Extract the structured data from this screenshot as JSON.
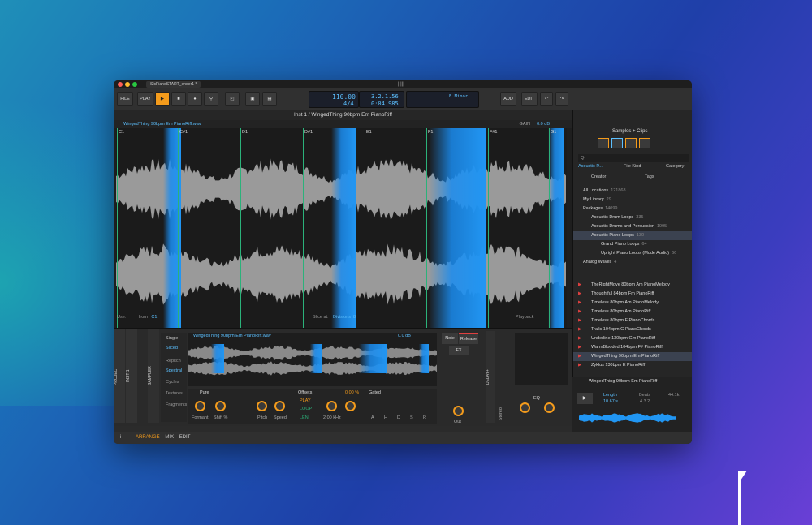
{
  "window": {
    "tab_title": "SlcPianoSTART_ender1 *",
    "logo": "|||||"
  },
  "toolbar": {
    "file": "FILE",
    "play": "PLAY",
    "add": "ADD",
    "edit": "EDIT",
    "tempo": "110.00",
    "sig": "4/4",
    "pos_bars": "3.2.1.56",
    "pos_time": "0:04.985",
    "key": "E Minor"
  },
  "clip": {
    "title": "Inst 1 / WingedThing 90bpm Em PianoRiff",
    "file": "WingedThing 90bpm Em PianoRiff.wav",
    "gain_label": "GAIN",
    "gain": "0.0 dB",
    "markers": [
      "C1",
      "C#1",
      "D1",
      "D#1",
      "E1",
      "F1",
      "F#1",
      "G1"
    ],
    "use_label": "Use:",
    "from_label": "from",
    "from_value": "C1",
    "slice_label": "Slice at:",
    "slice_mode": "Divisions",
    "slice_count": "8",
    "playback_label": "Playback"
  },
  "sampler": {
    "label": "SAMPLER",
    "project": "PROJECT",
    "inst": "INST 1",
    "modes": [
      "Single",
      "Sliced",
      "Repitch",
      "Spectral",
      "Cycles",
      "Textures",
      "Fragments"
    ],
    "file": "WingedThing 90bpm Em PianoRiff.wav",
    "gain": "0.0 dB",
    "note": "Note",
    "release": "Release",
    "fx": "FX",
    "pure": "Pure",
    "formant": "Formant",
    "shift": "Shift %",
    "pitch": "Pitch",
    "speed": "Speed",
    "offsets": "Offsets",
    "play": "PLAY",
    "loop": "LOOP",
    "len": "LEN",
    "pct": "0.00 %",
    "khz": "2.00 kHz",
    "gated": "Gated",
    "adsr": [
      "A",
      "H",
      "D",
      "S",
      "R"
    ],
    "out": "Out",
    "eq": "EQ",
    "delay": "DELAY+",
    "stereo": "Stereo"
  },
  "browser": {
    "title": "Samples + Clips",
    "search": "Q-",
    "filters": [
      "Acoustic P...",
      "File Kind",
      "Category",
      "Creator",
      "Tags"
    ],
    "tree": [
      {
        "label": "All Locations",
        "count": "121868"
      },
      {
        "label": "My Library",
        "count": "29"
      },
      {
        "label": "Packages",
        "count": "14099"
      },
      {
        "label": "Acoustic Drum Loops",
        "count": "335"
      },
      {
        "label": "Acoustic Drums and Percussion",
        "count": "1995"
      },
      {
        "label": "Acoustic Piano Loops",
        "count": "130"
      },
      {
        "label": "Grand Piano Loops",
        "count": "64"
      },
      {
        "label": "Upright Piano Loops (Mode Audio)",
        "count": "66"
      },
      {
        "label": "Analog Waves",
        "count": "4"
      }
    ],
    "files": [
      "TheRightMove 80bpm Am PianoMelody",
      "Thoughtful 84bpm Fm PianoRiff",
      "Timeless 80bpm Am PianoMelody",
      "Timeless 80bpm Am PianoRiff",
      "Timeless 80bpm F PianoChords",
      "Trails 104bpm G PianoChords",
      "Underline 130bpm Gm PianoRiff",
      "WarmBlooded 104bpm F# PianoRiff",
      "WingedThing 90bpm Em PianoRiff",
      "Zyklus 130bpm E PianoRiff"
    ],
    "preview": {
      "name": "WingedThing 90bpm Em PianoRiff",
      "length_label": "Length",
      "length": "10.67 s",
      "beats_label": "Beats",
      "beats": "4.3.2",
      "rate": "44.1k"
    }
  },
  "status": {
    "arrange": "ARRANGE",
    "mix": "MIX",
    "edit": "EDIT"
  }
}
